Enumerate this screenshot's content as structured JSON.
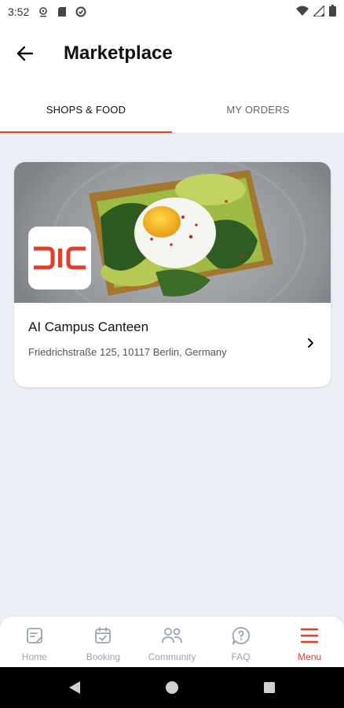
{
  "status_bar": {
    "time": "3:52",
    "left_icons": [
      "location-icon",
      "sd-card-icon",
      "data-saver-icon"
    ],
    "right_icons": [
      "wifi-icon",
      "signal-icon",
      "battery-icon"
    ]
  },
  "header": {
    "title": "Marketplace",
    "back_icon": "arrow-left-icon"
  },
  "tabs": [
    {
      "label": "SHOPS & FOOD",
      "active": true
    },
    {
      "label": "MY ORDERS",
      "active": false
    }
  ],
  "shops": [
    {
      "name": "AI Campus Canteen",
      "address": "Friedrichstraße 125, 10117 Berlin, Germany",
      "logo_text": "DIC",
      "image": "avocado-toast-with-poached-egg"
    }
  ],
  "bottom_nav": [
    {
      "label": "Home",
      "icon": "home-note-icon",
      "active": false
    },
    {
      "label": "Booking",
      "icon": "calendar-check-icon",
      "active": false
    },
    {
      "label": "Community",
      "icon": "people-icon",
      "active": false
    },
    {
      "label": "FAQ",
      "icon": "question-bubble-icon",
      "active": false
    },
    {
      "label": "Menu",
      "icon": "hamburger-menu-icon",
      "active": true
    }
  ],
  "colors": {
    "accent": "#E0402A",
    "background": "#ECEFF5",
    "inactive_nav": "#9AA3B2"
  }
}
